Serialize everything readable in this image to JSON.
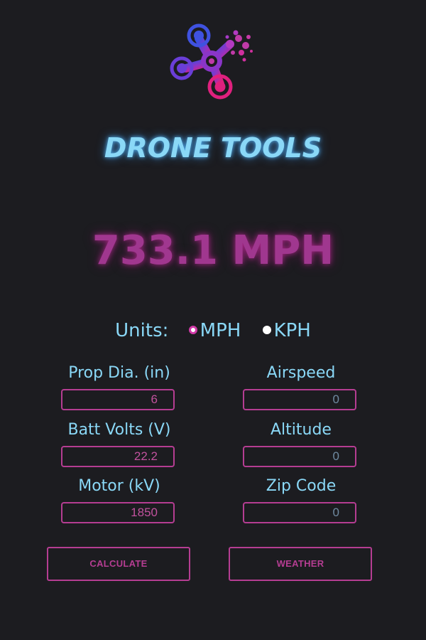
{
  "app": {
    "logo_icon": "drone-logo-icon",
    "title": "DRONE TOOLS"
  },
  "result": {
    "speed_text": "733.1 MPH"
  },
  "units": {
    "label": "Units:",
    "options": [
      {
        "label": "MPH",
        "selected": true
      },
      {
        "label": "KPH",
        "selected": false
      }
    ]
  },
  "fields": {
    "prop_diameter": {
      "label": "Prop Dia. (in)",
      "value": "6"
    },
    "batt_volts": {
      "label": "Batt Volts (V)",
      "value": "22.2"
    },
    "motor_kv": {
      "label": "Motor (kV)",
      "value": "1850"
    },
    "airspeed": {
      "label": "Airspeed",
      "value": "0"
    },
    "altitude": {
      "label": "Altitude",
      "value": "0"
    },
    "zip_code": {
      "label": "Zip Code",
      "value": "0"
    }
  },
  "buttons": {
    "calculate": "CALCULATE",
    "weather": "WEATHER"
  },
  "colors": {
    "background": "#1c1c20",
    "accent_cyan": "#8ad8f7",
    "accent_magenta": "#b53d92"
  }
}
